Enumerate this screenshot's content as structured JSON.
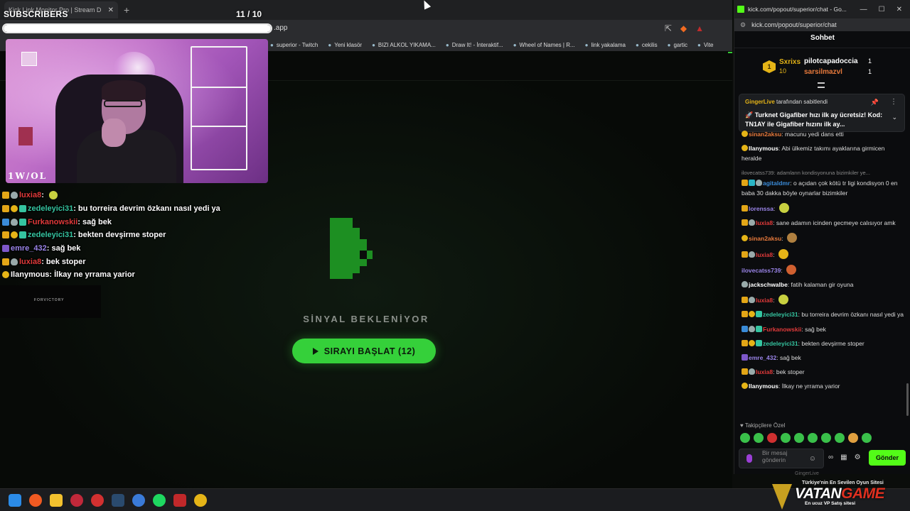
{
  "browser": {
    "tab_title": "Kick Link Monitor Pro | Stream D",
    "url_suffix": ".app",
    "bookmarks": [
      "superior - Twitch",
      "Yeni klasör",
      "BIZI ALKOL YIKAMA...",
      "Draw It! - İnteraktif...",
      "Wheel of Names | R...",
      "link yakalama",
      "cekilis",
      "gartic",
      "Vite"
    ]
  },
  "page": {
    "signal_text": "SİNYAL BEKLENİYOR",
    "start_button": "SIRAYI BAŞLAT (12)",
    "accent": "#35d03a"
  },
  "overlay": {
    "subs_label": "SUBSCRIBERS",
    "subs_count": "11   / 10",
    "subs_progress": 1.0,
    "cam_logo": "1W/OL",
    "sponsor": "FORVICTORY",
    "chat": [
      {
        "name": "luxia8",
        "color": "#e03a3a",
        "text": "",
        "badges": [
          "b-sub",
          "b-shield"
        ],
        "emoji": true
      },
      {
        "name": "zedeleyici31",
        "color": "#35c4a0",
        "text": "bu torreira devrim özkanı nasıl yedi ya",
        "badges": [
          "b-sub",
          "b-coin",
          "b-gift"
        ]
      },
      {
        "name": "Furkanowskii",
        "color": "#e03a3a",
        "text": "sağ bek",
        "badges": [
          "b-blue",
          "b-shield",
          "b-gift"
        ]
      },
      {
        "name": "zedeleyici31",
        "color": "#35c4a0",
        "text": "bekten devşirme stoper",
        "badges": [
          "b-sub",
          "b-coin",
          "b-gift"
        ]
      },
      {
        "name": "emre_432",
        "color": "#9a84e8",
        "text": "sağ bek",
        "badges": [
          "b-purple"
        ]
      },
      {
        "name": "luxia8",
        "color": "#e03a3a",
        "text": "bek stoper",
        "badges": [
          "b-sub",
          "b-shield"
        ]
      },
      {
        "name": "Ilanymous",
        "color": "#ffffff",
        "text": "İlkay ne yrrama yarior",
        "badges": [
          "b-coin"
        ]
      }
    ]
  },
  "kick": {
    "window_title": "kick.com/popout/superior/chat - Go...",
    "url": "kick.com/popout/superior/chat",
    "header": "Sohbet",
    "leaderboard": {
      "first_name": "Sxrixs",
      "first_count": "10",
      "second_name": "pilotcapadoccia",
      "second_count": "1",
      "third_name": "sarsilmazvl",
      "third_count": "1",
      "rank": "1"
    },
    "pinned": {
      "by_name": "GingerLive",
      "by_suffix": "tarafından sabitlendi",
      "message": "🚀 Turknet Gigafiber hızı ilk ay ücretsiz! Kod: TN1AY ile Gigafiber hızını ilk ay..."
    },
    "messages": [
      {
        "name": "sinan2aksu",
        "color": "#e87a3c",
        "text": "macunu yedi dans etti",
        "badges": [
          "b-coin"
        ]
      },
      {
        "name": "Ilanymous",
        "color": "#ffffff",
        "text": "Abi ülkemiz takımı ayaklarına girmicen heralde",
        "badges": [
          "b-coin"
        ]
      },
      {
        "reply": "ilovecatss739: adamların kondisyonuna bizimkiler ye..."
      },
      {
        "name": "agitaldmr",
        "color": "#3a8bd8",
        "text": "o açıdan çok kötü tr ligi kondisyon 0 en baba 30 dakka böyle oynarlar bizimkiler",
        "badges": [
          "b-sub",
          "b-cyan",
          "b-shield"
        ]
      },
      {
        "name": "lorenssa",
        "color": "#9a84e8",
        "text": "",
        "badges": [
          "b-sub"
        ],
        "emo": "#c8d040"
      },
      {
        "name": "luxia8",
        "color": "#e03a3a",
        "text": "sane adamın icinden gecmeye calısıyor amk",
        "badges": [
          "b-sub",
          "b-shield"
        ]
      },
      {
        "name": "sinan2aksu",
        "color": "#e87a3c",
        "text": "",
        "badges": [
          "b-coin"
        ],
        "emo": "#b08040"
      },
      {
        "name": "luxia8",
        "color": "#e03a3a",
        "text": "",
        "badges": [
          "b-sub",
          "b-shield"
        ],
        "emo": "#e5b417"
      },
      {
        "name": "ilovecatss739",
        "color": "#9a84e8",
        "text": "",
        "badges": [],
        "emo": "#d06030"
      },
      {
        "name": "jackschwalbe",
        "color": "#ffffff",
        "text": "fatih kalaman gir oyuna",
        "badges": [
          "b-shield"
        ]
      },
      {
        "name": "luxia8",
        "color": "#e03a3a",
        "text": "",
        "badges": [
          "b-sub",
          "b-shield"
        ],
        "emo": "#c8d040"
      },
      {
        "name": "zedeleyici31",
        "color": "#35c4a0",
        "text": "bu torreira devrim özkanı nasıl yedi ya",
        "badges": [
          "b-sub",
          "b-coin",
          "b-gift"
        ]
      },
      {
        "name": "Furkanowskii",
        "color": "#e03a3a",
        "text": "sağ bek",
        "badges": [
          "b-blue",
          "b-shield",
          "b-gift"
        ]
      },
      {
        "name": "zedeleyici31",
        "color": "#35c4a0",
        "text": "bekten devşirme stoper",
        "badges": [
          "b-sub",
          "b-coin",
          "b-gift"
        ]
      },
      {
        "name": "emre_432",
        "color": "#9a84e8",
        "text": "sağ bek",
        "badges": [
          "b-purple"
        ]
      },
      {
        "name": "luxia8",
        "color": "#e03a3a",
        "text": "bek stoper",
        "badges": [
          "b-sub",
          "b-shield"
        ]
      },
      {
        "name": "Ilanymous",
        "color": "#ffffff",
        "text": "İlkay ne yrrama yarior",
        "badges": [
          "b-coin"
        ]
      }
    ],
    "follower_only": "Takipçilere Özel",
    "input_placeholder": "Bir mesaj gönderin",
    "send_label": "Gönder"
  },
  "taskbar": {
    "brand_top": "Türkiye'nin En Sevilen Oyun Sitesi",
    "brand_name_a": "VATAN",
    "brand_name_b": "GAME",
    "brand_sub": "En ucuz VP Satış sitesi",
    "ghost": "GingerLive"
  }
}
